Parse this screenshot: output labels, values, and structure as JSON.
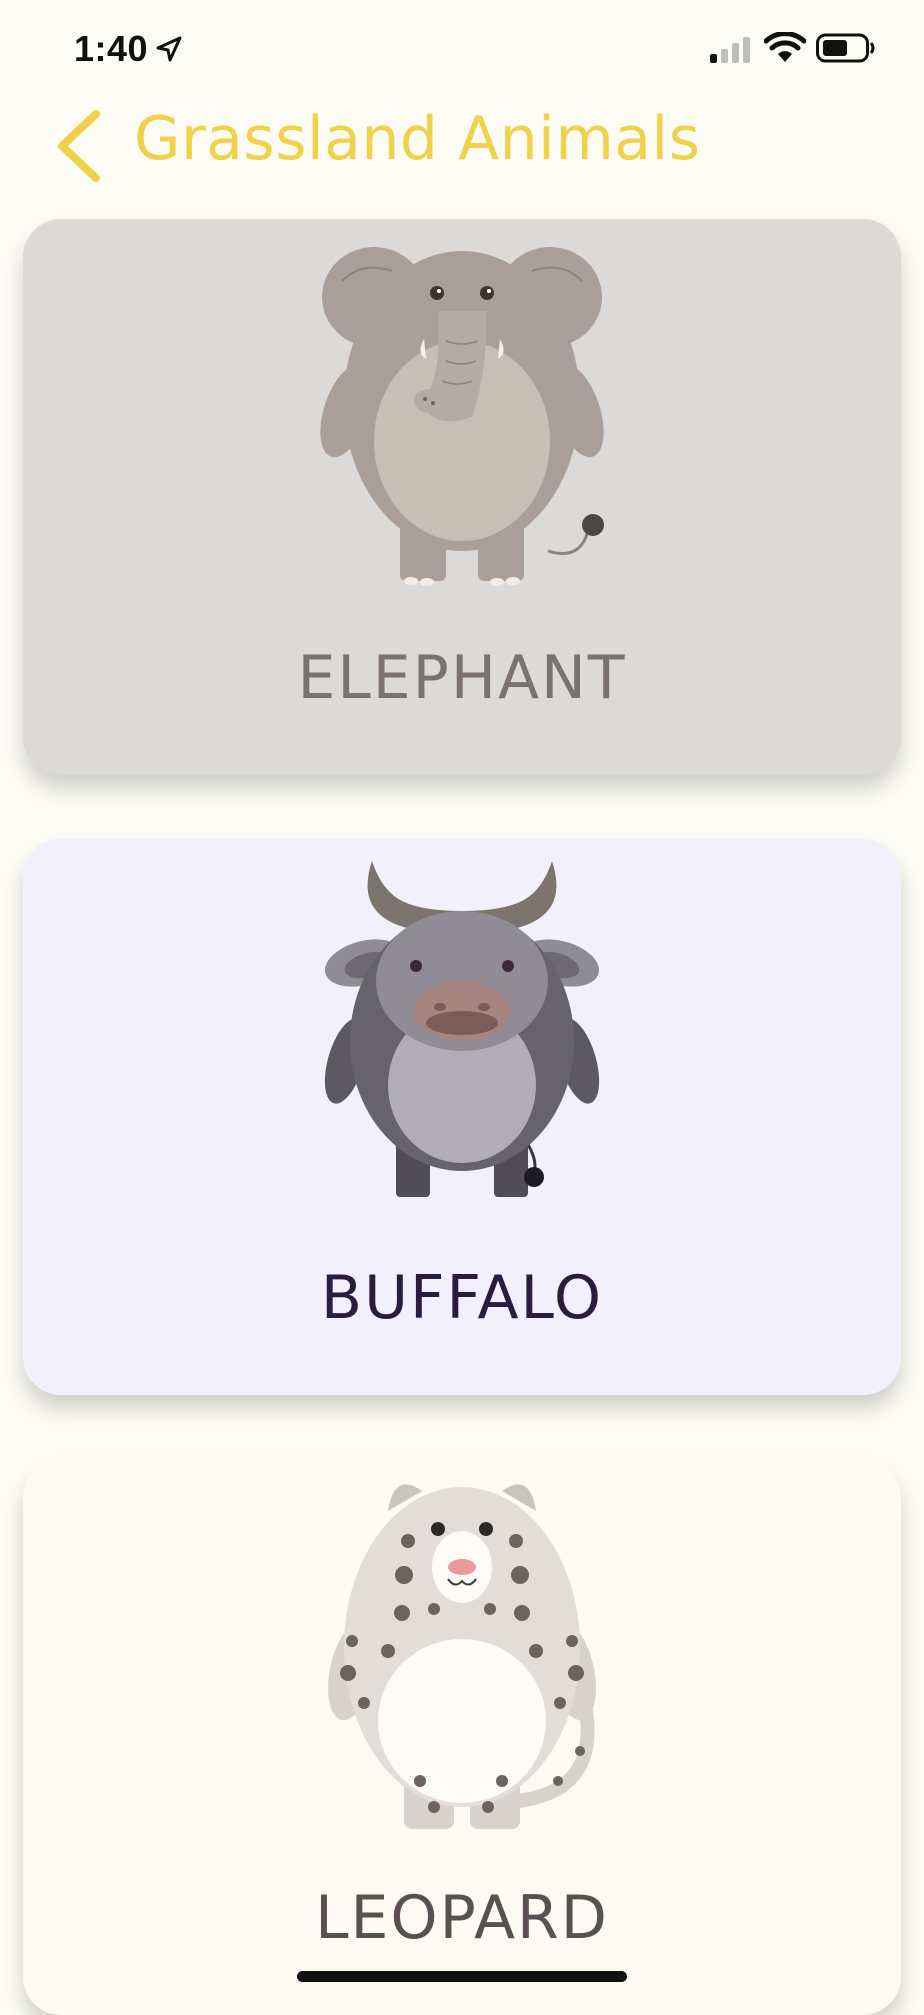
{
  "status_bar": {
    "time": "1:40",
    "icons": [
      "location-arrow-icon",
      "cellular-signal-icon",
      "wifi-icon",
      "battery-icon"
    ]
  },
  "header": {
    "title": "Grassland Animals",
    "back_icon": "chevron-left-icon",
    "title_color": "#f0d24a"
  },
  "cards": [
    {
      "name": "ELEPHANT",
      "bg": "#dcdad6",
      "label_color": "#7a7270",
      "image": "elephant-illustration"
    },
    {
      "name": "BUFFALO",
      "bg": "#f2f0fc",
      "label_color": "#2a1c3c",
      "image": "buffalo-illustration"
    },
    {
      "name": "LEOPARD",
      "bg": "#fcfaf3",
      "label_color": "#5a5052",
      "image": "leopard-illustration"
    }
  ]
}
